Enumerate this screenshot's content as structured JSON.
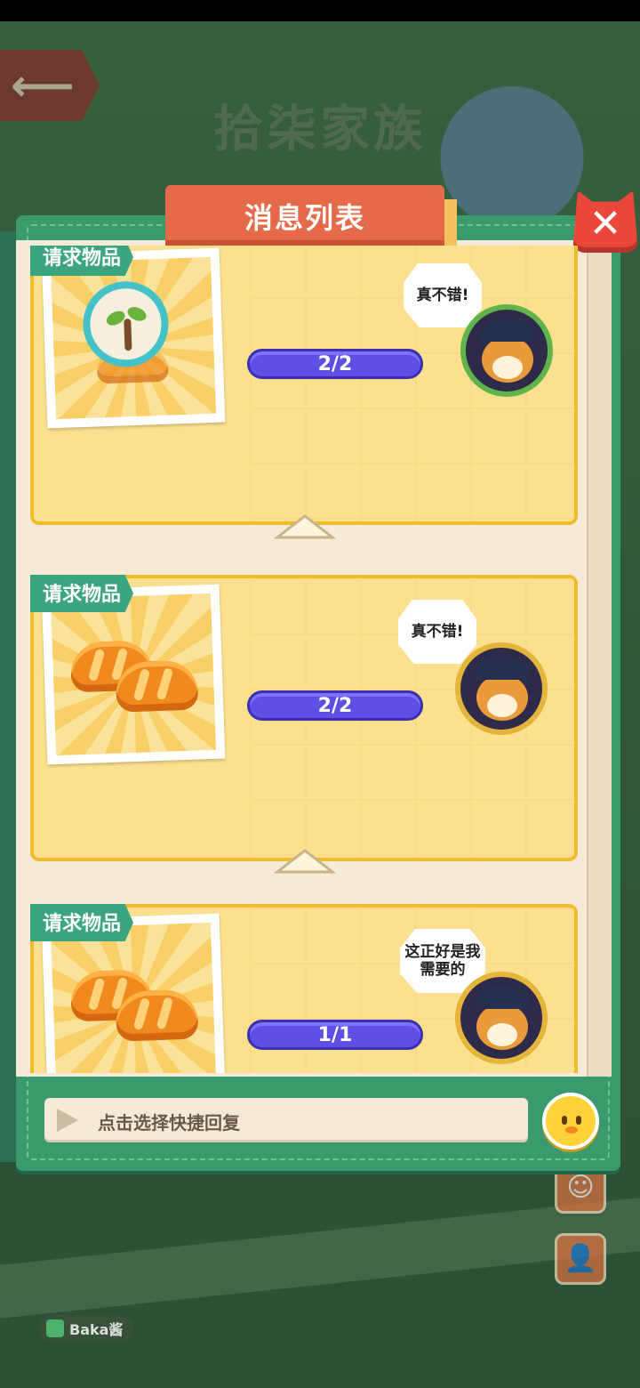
{
  "background": {
    "family_title": "拾柒家族",
    "player_name": "Baka酱"
  },
  "dialog": {
    "title": "消息列表",
    "close_label": "✕"
  },
  "messages": [
    {
      "request_label": "请求物品",
      "item": "sprout-in-bubble",
      "progress": "2/2",
      "speech": "真不错!"
    },
    {
      "request_label": "请求物品",
      "item": "croissants",
      "progress": "2/2",
      "speech": "真不错!"
    },
    {
      "request_label": "请求物品",
      "item": "croissants",
      "progress": "1/1",
      "speech": "这正好是我需要的"
    }
  ],
  "footer": {
    "quick_reply_placeholder": "点击选择快捷回复"
  },
  "colors": {
    "panel": "#3b9a6d",
    "card": "#fbe08f",
    "card_border": "#f0bc2d",
    "progress": "#5e50e4",
    "tab": "#e46a49",
    "close": "#e8473a"
  }
}
